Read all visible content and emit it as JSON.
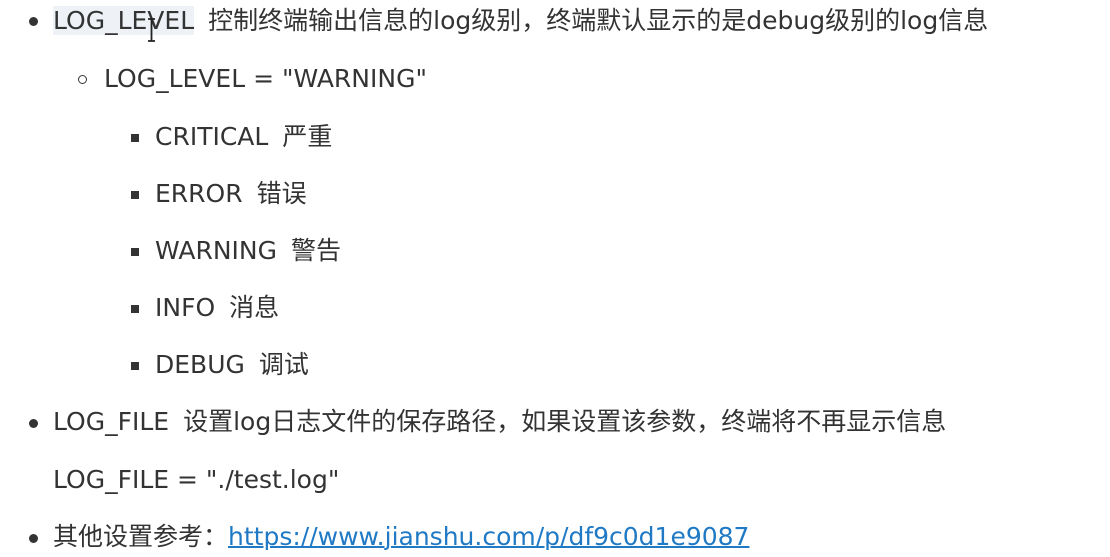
{
  "items": {
    "log_level": {
      "key": "LOG_LEVEL",
      "desc": "控制终端输出信息的log级别，终端默认显示的是debug级别的log信息",
      "example": "LOG_LEVEL = \"WARNING\"",
      "levels": [
        {
          "name": "CRITICAL",
          "meaning": "严重"
        },
        {
          "name": "ERROR",
          "meaning": "错误"
        },
        {
          "name": "WARNING",
          "meaning": "警告"
        },
        {
          "name": "INFO",
          "meaning": "消息"
        },
        {
          "name": "DEBUG",
          "meaning": "调试"
        }
      ]
    },
    "log_file": {
      "key": "LOG_FILE",
      "desc": "设置log日志文件的保存路径，如果设置该参数，终端将不再显示信息",
      "example": "LOG_FILE = \"./test.log\""
    },
    "other": {
      "label": "其他设置参考：",
      "link": "https://www.jianshu.com/p/df9c0d1e9087"
    }
  },
  "colors": {
    "text": "#333333",
    "link": "#1f79c4",
    "code_highlight": "#eef2f7"
  }
}
